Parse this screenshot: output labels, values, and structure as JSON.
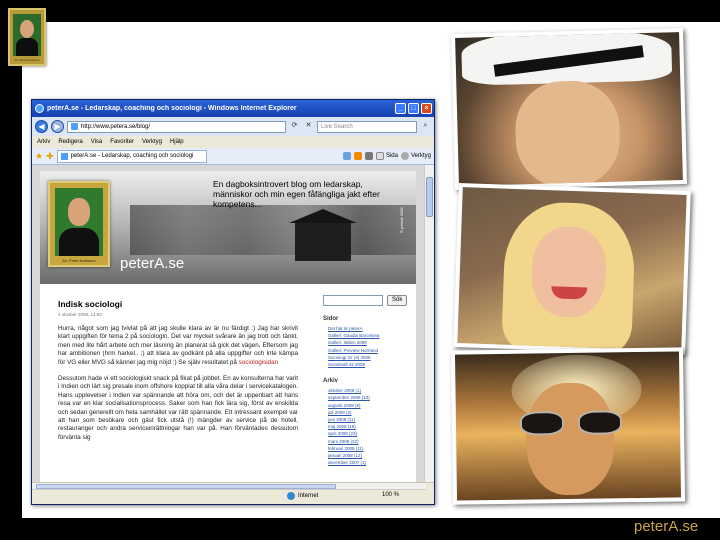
{
  "corner_avatar": {
    "caption": "Av: Peter Axelsson"
  },
  "browser": {
    "title": "peterA.se - Ledarskap, coaching och sociologi - Windows Internet Explorer",
    "url": "http://www.petera.se/blog/",
    "search_placeholder": "Live Search",
    "menu": [
      "Arkiv",
      "Redigera",
      "Visa",
      "Favoriter",
      "Verktyg",
      "Hjälp"
    ],
    "tab_label": "peterA.se - Ledarskap, coaching och sociologi",
    "toolbar": {
      "page": "Sida",
      "tools": "Verktyg"
    },
    "status": {
      "zone": "Internet",
      "zoom": "100 %"
    }
  },
  "blog": {
    "tagline": "En dagboksintrovert blog om ledarskap, människor och min egen fåfängliga jakt efter kompetens...",
    "site_name": "peterA.se",
    "header_copyright": "© peterA 2008",
    "portrait_caption": "Av: Peter Axelsson",
    "post": {
      "title": "Indisk sociologi",
      "date": "4 oktober 2008, 14:50",
      "p1": "Hurra, något som jag tvivlat på att jag skulle klara av är nu färdigt :) Jag har skrivit klart uppgiften för tema 2 på sociologin. Det var mycket svårare än jag trott och tänkt, men med lite hårt arbete och mer läsning än planerat så gick det vägen. Eftersom jag har ambitionen (hrm harkel.. ;) att klara av godkänt på alla uppgifter och inte kämpa för VG eller MVG så känner jag mig nöjd :) Se själv resultatet på",
      "p1_link": "sociologisidan",
      "p2": "Dessutom hade vi ett sociologiskt snack på fikat på jobbet. En av konsulterna har varit i Indien och lärt sig presale inom offshore kopplat till alla våra delar i servicekatalogen. Hans upplevelser i Indien var spännande att höra om, och det är uppenbart att hans resa var en klar socialisationsprocess. Saker som han fick lära sig, först av enskilda och sedan generellt om hela samhället var rätt spännande. Ett intressant exempel var att han som besökare och gäst fick utstå (!) mängder av service på de hotell, restauranger och andra serviceinrättningar han var på. Han förväntades dessutom förvänta sig"
    },
    "sidebar": {
      "search_button": "Sök",
      "pages_heading": "Sidor",
      "pages": [
        "Det här är peterA",
        "Galleri: Gaudia Barcelona",
        "Galleri: Italien 2008",
        "Galleri: Preview Norrland",
        "Sociologi Gr (4) 2008",
        "Sundsvall 42 2008"
      ],
      "archive_heading": "Arkiv",
      "archive": [
        "oktober 2008 (1)",
        "september 2008 (13)",
        "augusti 2008 (8)",
        "juli 2008 (2)",
        "juni 2008 (11)",
        "maj 2008 (16)",
        "april 2008 (23)",
        "mars 2008 (22)",
        "februari 2008 (11)",
        "januari 2008 (12)",
        "december 2007 (1)"
      ]
    }
  },
  "brand": "peterA.se"
}
